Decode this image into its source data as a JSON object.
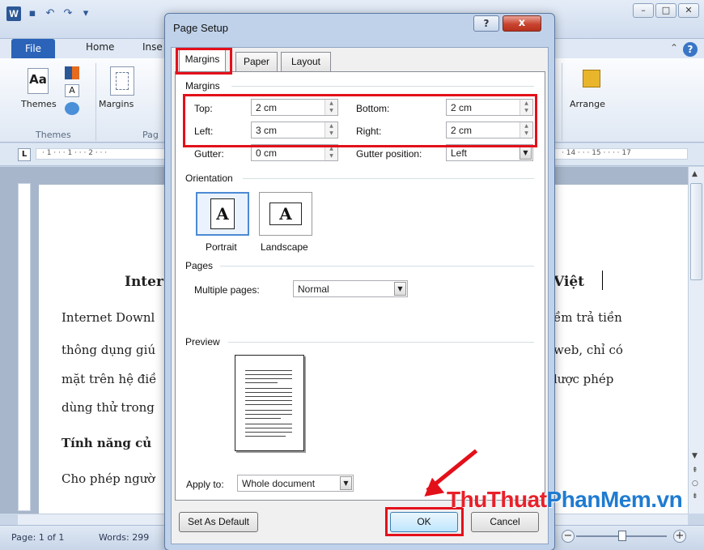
{
  "word": {
    "tabs": [
      "File",
      "Home",
      "Inse"
    ],
    "ribbon": {
      "themes_label": "Themes",
      "themes_group": "Themes",
      "margins_label": "Margins",
      "page_group_partial": "Pag",
      "arrange_label": "Arrange"
    },
    "document": {
      "heading_left": "Inter",
      "heading_right": "Việt",
      "line1_left": "Internet Downl",
      "line1_right": "ềm trả tiền",
      "line2_left": "thông dụng giú",
      "line2_right": "web, chỉ có",
      "line3_left": "mặt trên hệ điề",
      "line3_right": "lược phép",
      "line4_left": "dùng thử trong",
      "section_left": "Tính năng củ",
      "line5_left": "Cho phép ngườ"
    },
    "status": {
      "page": "Page: 1 of 1",
      "words": "Words: 299"
    },
    "ruler_numbers_left": "· 1 · · · 1 · · · 2 · · ·",
    "ruler_numbers_right": "· 14 · · · 15 · · · · 17"
  },
  "dialog": {
    "title": "Page Setup",
    "help_label": "?",
    "close_label": "x",
    "tabs": [
      "Margins",
      "Paper",
      "Layout"
    ],
    "margins_section": "Margins",
    "fields": {
      "top_label": "Top:",
      "top_value": "2 cm",
      "bottom_label": "Bottom:",
      "bottom_value": "2 cm",
      "left_label": "Left:",
      "left_value": "3 cm",
      "right_label": "Right:",
      "right_value": "2 cm",
      "gutter_label": "Gutter:",
      "gutter_value": "0 cm",
      "gutter_position_label": "Gutter position:",
      "gutter_position_value": "Left"
    },
    "orientation_section": "Orientation",
    "portrait_label": "Portrait",
    "landscape_label": "Landscape",
    "orientation_glyph": "A",
    "pages_section": "Pages",
    "multiple_pages_label": "Multiple pages:",
    "multiple_pages_value": "Normal",
    "preview_section": "Preview",
    "apply_to_label": "Apply to:",
    "apply_to_value": "Whole document",
    "set_default_label": "Set As Default",
    "ok_label": "OK",
    "cancel_label": "Cancel"
  },
  "watermark": {
    "part1": "ThuThuat",
    "part2": "PhanMem",
    "part3": ".vn"
  },
  "colors": {
    "highlight": "#e3101a",
    "file_tab": "#2a63b8",
    "watermark_red": "#e8202a",
    "watermark_blue": "#1f7bd1"
  }
}
